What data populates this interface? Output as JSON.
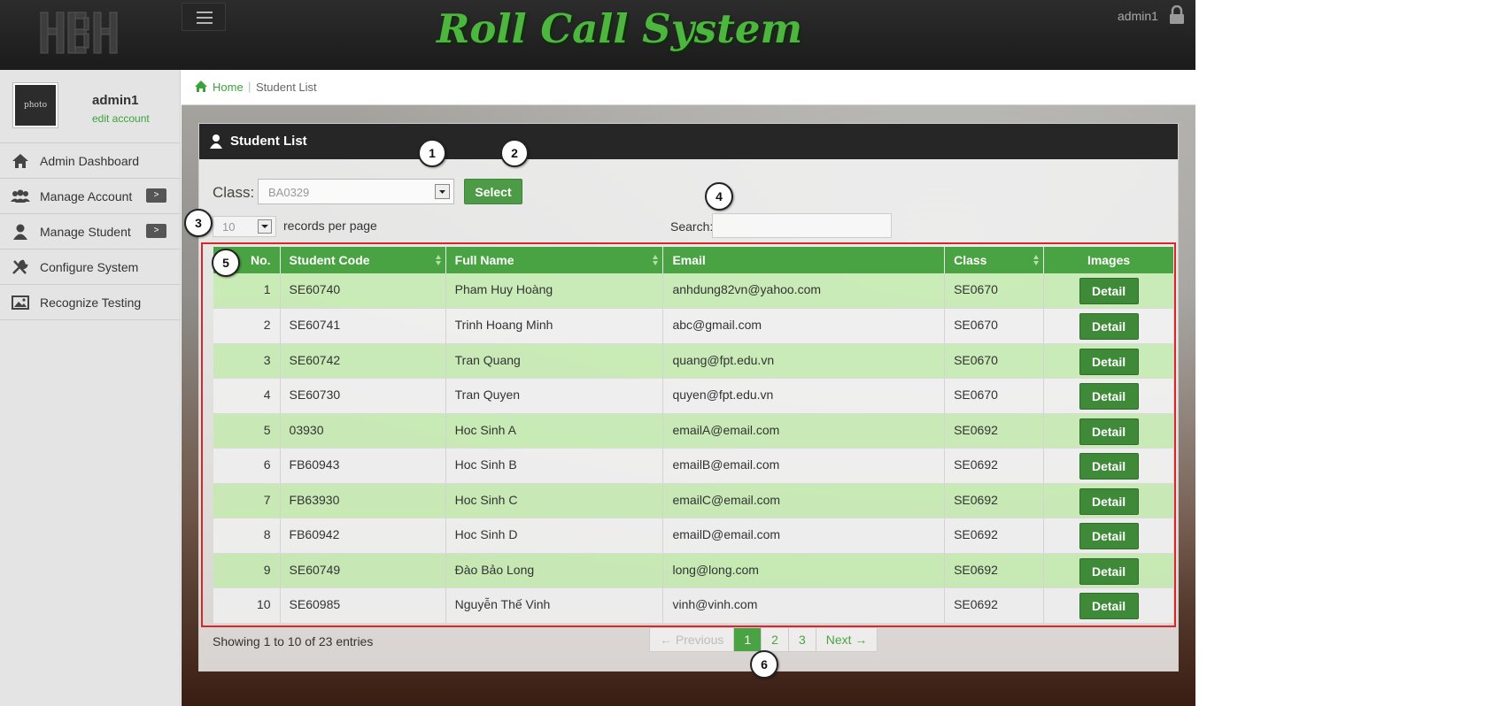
{
  "header": {
    "logo_text": "HBH",
    "app_title": "Roll Call System",
    "user": "admin1"
  },
  "sidebar": {
    "avatar_text": "photo",
    "profile_name": "admin1",
    "profile_link": "edit account",
    "items": [
      {
        "label": "Admin Dashboard",
        "icon": "home-icon"
      },
      {
        "label": "Manage Account",
        "icon": "users-icon",
        "badge": ">"
      },
      {
        "label": "Manage Student",
        "icon": "user-icon",
        "badge": ">"
      },
      {
        "label": "Configure System",
        "icon": "tools-icon"
      },
      {
        "label": "Recognize Testing",
        "icon": "image-icon"
      }
    ]
  },
  "breadcrumb": {
    "home": "Home",
    "current": "Student List"
  },
  "panel": {
    "title": "Student List",
    "class_label": "Class:",
    "class_value": "BA0329",
    "select_label": "Select",
    "per_page_value": "10",
    "per_page_label": "records per page",
    "search_label": "Search:",
    "search_value": ""
  },
  "table": {
    "columns": [
      "No.",
      "Student Code",
      "Full Name",
      "Email",
      "Class",
      "Images"
    ],
    "rows": [
      {
        "no": "1",
        "code": "SE60740",
        "name": "Pham Huy Hoàng",
        "email": "anhdung82vn@yahoo.com",
        "class": "SE0670",
        "action": "Detail"
      },
      {
        "no": "2",
        "code": "SE60741",
        "name": "Trinh Hoang Minh",
        "email": "abc@gmail.com",
        "class": "SE0670",
        "action": "Detail"
      },
      {
        "no": "3",
        "code": "SE60742",
        "name": "Tran Quang",
        "email": "quang@fpt.edu.vn",
        "class": "SE0670",
        "action": "Detail"
      },
      {
        "no": "4",
        "code": "SE60730",
        "name": "Tran Quyen",
        "email": "quyen@fpt.edu.vn",
        "class": "SE0670",
        "action": "Detail"
      },
      {
        "no": "5",
        "code": "03930",
        "name": "Hoc Sinh A",
        "email": "emailA@email.com",
        "class": "SE0692",
        "action": "Detail"
      },
      {
        "no": "6",
        "code": "FB60943",
        "name": "Hoc Sinh B",
        "email": "emailB@email.com",
        "class": "SE0692",
        "action": "Detail"
      },
      {
        "no": "7",
        "code": "FB63930",
        "name": "Hoc Sinh C",
        "email": "emailC@email.com",
        "class": "SE0692",
        "action": "Detail"
      },
      {
        "no": "8",
        "code": "FB60942",
        "name": "Hoc Sinh D",
        "email": "emailD@email.com",
        "class": "SE0692",
        "action": "Detail"
      },
      {
        "no": "9",
        "code": "SE60749",
        "name": "Đào Bảo Long",
        "email": "long@long.com",
        "class": "SE0692",
        "action": "Detail"
      },
      {
        "no": "10",
        "code": "SE60985",
        "name": "Nguyễn Thế Vinh",
        "email": "vinh@vinh.com",
        "class": "SE0692",
        "action": "Detail"
      }
    ]
  },
  "footer": {
    "info": "Showing 1 to 10 of 23 entries",
    "pagination": {
      "previous": "← Previous",
      "pages": [
        "1",
        "2",
        "3"
      ],
      "current_page": "1",
      "next": "Next →"
    }
  },
  "markers": [
    "1",
    "2",
    "3",
    "4",
    "5",
    "6"
  ],
  "colors": {
    "accent": "#4aa342",
    "header": "#1f1f1f",
    "highlight": "#d9262a"
  }
}
